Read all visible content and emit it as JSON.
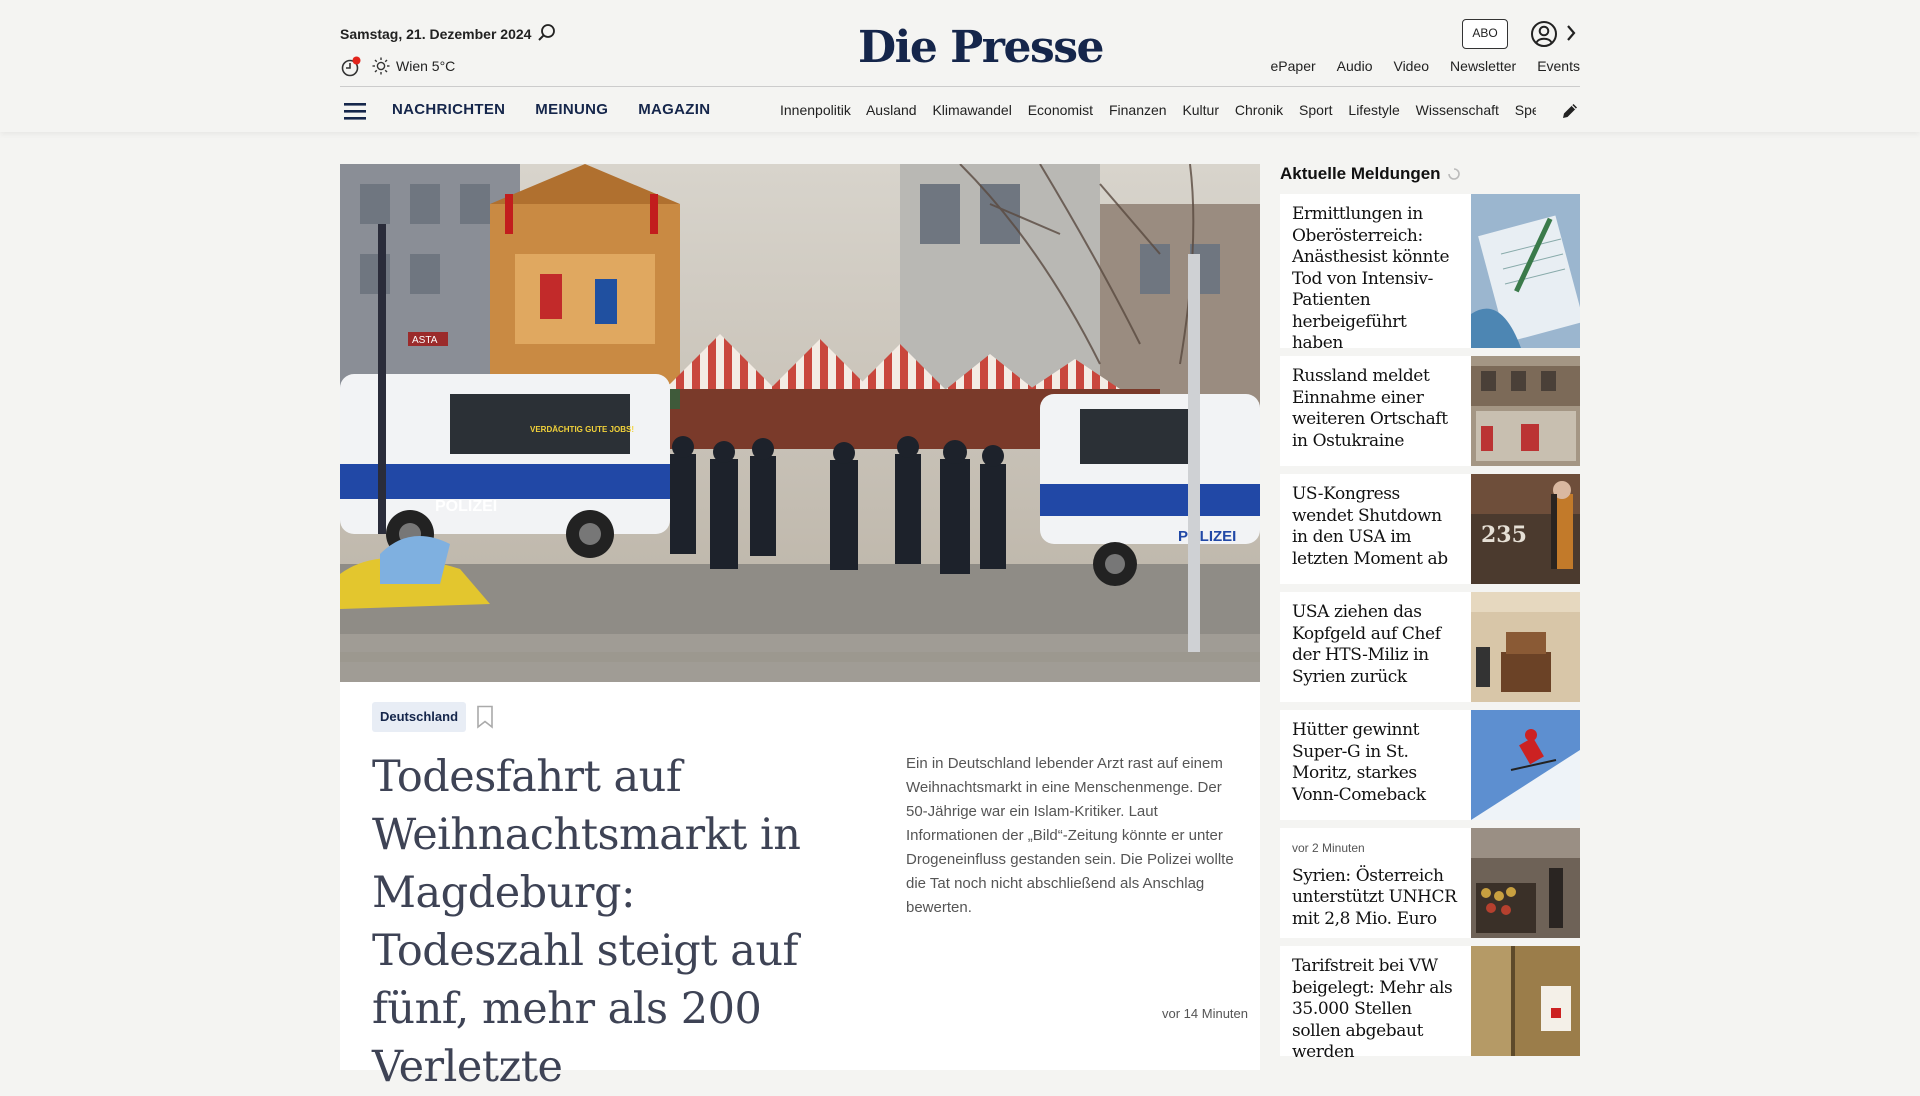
{
  "header": {
    "date": "Samstag, 21. Dezember 2024",
    "weather": "Wien 5°C",
    "logo": "Die Presse",
    "abo": "ABO",
    "links": [
      "ePaper",
      "Audio",
      "Video",
      "Newsletter",
      "Events"
    ],
    "main_nav": [
      "NACHRICHTEN",
      "MEINUNG",
      "MAGAZIN"
    ],
    "sub_nav": [
      "Innenpolitik",
      "Ausland",
      "Klimawandel",
      "Economist",
      "Finanzen",
      "Kultur",
      "Chronik",
      "Sport",
      "Lifestyle",
      "Wissenschaft",
      "Spectrum"
    ]
  },
  "hero": {
    "tag": "Deutschland",
    "headline": "Todesfahrt auf Weihnachtsmarkt in Magdeburg: Todeszahl steigt auf fünf, mehr als 200 Verletzte",
    "teaser": "Ein in Deutschland lebender Arzt rast auf einem Weihnachtsmarkt in eine Menschenmenge. Der 50-Jährige war ein Islam-Kritiker. Laut Informationen der „Bild“-Zeitung könnte er unter Drogeneinfluss gestanden sein. Die Polizei wollte die Tat noch nicht abschließend als Anschlag bewerten.",
    "time": "vor 14 Minuten",
    "image_text": {
      "van_left": "POLIZEI",
      "van_right": "POLIZEI",
      "van_sign": "VERDÄCHTIG GUTE JOBS!",
      "sign": "ASTA"
    }
  },
  "sidebar": {
    "title": "Aktuelle Meldungen",
    "items": [
      {
        "title": "Ermittlungen in Oberösterreich: Anästhesist könnte Tod von Intensiv-Patienten herbeigeführt haben",
        "meta": ""
      },
      {
        "title": "Russland meldet Einnahme einer weiteren Ortschaft in Ostukraine",
        "meta": ""
      },
      {
        "title": "US-Kongress wendet Shutdown in den USA im letzten Moment ab",
        "meta": "",
        "image_text": "235"
      },
      {
        "title": "USA ziehen das Kopfgeld auf Chef der HTS-Miliz in Syrien zurück",
        "meta": ""
      },
      {
        "title": "Hütter gewinnt Super-G in St. Moritz, starkes Vonn-Comeback",
        "meta": ""
      },
      {
        "title": "Syrien: Österreich unterstützt UNHCR mit 2,8 Mio. Euro",
        "meta": "vor 2 Minuten"
      },
      {
        "title": "Tarifstreit bei VW beigelegt: Mehr als 35.000 Stellen sollen abgebaut werden",
        "meta": ""
      }
    ]
  },
  "colors": {
    "brand": "#15264b",
    "background": "#f4f4f2",
    "headline": "#3e4355",
    "notification": "#e2231a"
  },
  "icons": [
    "search-icon",
    "clock-icon",
    "sun-icon",
    "user-icon",
    "chevron-right-icon",
    "menu-icon",
    "pen-icon",
    "bookmark-icon",
    "loading-icon"
  ]
}
